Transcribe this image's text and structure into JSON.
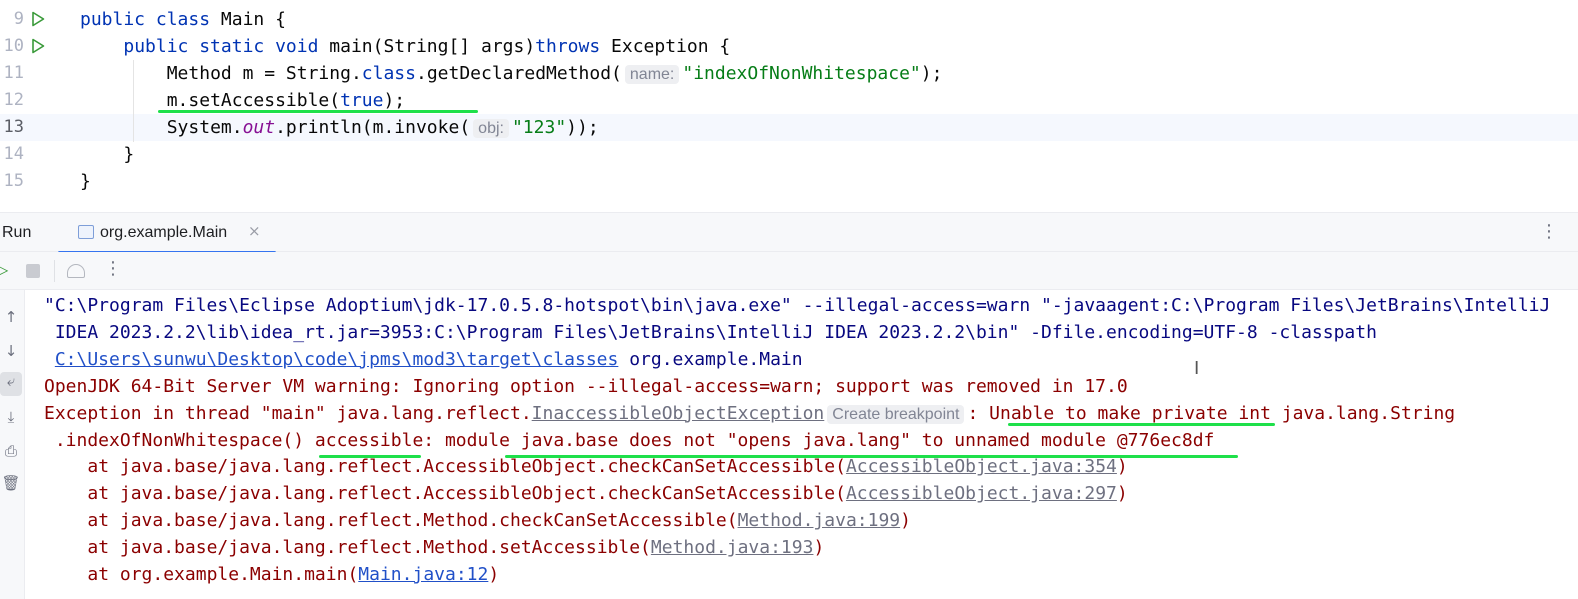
{
  "editor": {
    "current_line": 13,
    "lines": [
      {
        "num": "9",
        "run": true,
        "indent": 0,
        "tokens": [
          {
            "t": "public class ",
            "c": "kw"
          },
          {
            "t": "Main {",
            "c": "pl"
          }
        ]
      },
      {
        "num": "10",
        "run": true,
        "indent": 4,
        "tokens": [
          {
            "t": "public static void ",
            "c": "kw"
          },
          {
            "t": "main(String[] args)",
            "c": "pl"
          },
          {
            "t": "throws ",
            "c": "kw"
          },
          {
            "t": "Exception {",
            "c": "pl"
          }
        ]
      },
      {
        "num": "11",
        "run": false,
        "indent": 8,
        "tokens": [
          {
            "t": "Method m = String.",
            "c": "pl"
          },
          {
            "t": "class",
            "c": "kw"
          },
          {
            "t": ".getDeclaredMethod(",
            "c": "pl"
          },
          {
            "t": "name:",
            "c": "hint"
          },
          {
            "t": "\"indexOfNonWhitespace\"",
            "c": "str"
          },
          {
            "t": ");",
            "c": "pl"
          }
        ]
      },
      {
        "num": "12",
        "run": false,
        "indent": 8,
        "tokens": [
          {
            "t": "m.setAccessible(",
            "c": "pl"
          },
          {
            "t": "true",
            "c": "kw"
          },
          {
            "t": ");",
            "c": "pl"
          }
        ]
      },
      {
        "num": "13",
        "run": false,
        "indent": 8,
        "tokens": [
          {
            "t": "System.",
            "c": "pl"
          },
          {
            "t": "out",
            "c": "fld"
          },
          {
            "t": ".println(m.invoke(",
            "c": "pl"
          },
          {
            "t": "obj:",
            "c": "hint"
          },
          {
            "t": "\"123\"",
            "c": "str"
          },
          {
            "t": "));",
            "c": "pl"
          }
        ]
      },
      {
        "num": "14",
        "run": false,
        "indent": 4,
        "tokens": [
          {
            "t": "}",
            "c": "pl"
          }
        ]
      },
      {
        "num": "15",
        "run": false,
        "indent": 0,
        "tokens": [
          {
            "t": "}",
            "c": "pl"
          }
        ]
      }
    ]
  },
  "run_panel": {
    "title": "Run",
    "tab_label": "org.example.Main",
    "accent": "#3574f0"
  },
  "console": {
    "lines": [
      {
        "indent": 0,
        "tokens": [
          {
            "t": "\"C:\\Program Files\\Eclipse Adoptium\\jdk-17.0.5.8-hotspot\\bin\\java.exe\" --illegal-access=warn \"-javaagent:C:\\Program Files\\JetBrains\\IntelliJ",
            "c": ""
          }
        ]
      },
      {
        "indent": 1,
        "tokens": [
          {
            "t": "IDEA 2023.2.2\\lib\\idea_rt.jar=3953:C:\\Program Files\\JetBrains\\IntelliJ IDEA 2023.2.2\\bin\" -Dfile.encoding=UTF-8 -classpath",
            "c": ""
          }
        ]
      },
      {
        "indent": 1,
        "tokens": [
          {
            "t": "C:\\Users\\sunwu\\Desktop\\code\\jpms\\mod3\\target\\classes",
            "c": "lnk"
          },
          {
            "t": " org.example.Main",
            "c": ""
          }
        ]
      },
      {
        "indent": 0,
        "tokens": [
          {
            "t": "OpenJDK 64-Bit Server VM warning: Ignoring option --illegal-access=warn; support was removed in 17.0",
            "c": "err"
          }
        ]
      },
      {
        "indent": 0,
        "tokens": [
          {
            "t": "Exception in thread \"main\" java.lang.reflect.",
            "c": "err"
          },
          {
            "t": "InaccessibleObjectException",
            "c": "glnk"
          },
          {
            "t": "Create breakpoint",
            "c": "hint"
          },
          {
            "t": ": Unable to make private int java.lang.String",
            "c": "err"
          }
        ]
      },
      {
        "indent": 1,
        "tokens": [
          {
            "t": ".indexOfNonWhitespace() accessible: module java.base does not \"opens java.lang\" to unnamed module @776ec8df",
            "c": "err"
          }
        ]
      },
      {
        "indent": 4,
        "tokens": [
          {
            "t": "at java.base/java.lang.reflect.AccessibleObject.checkCanSetAccessible(",
            "c": "err"
          },
          {
            "t": "AccessibleObject.java:354",
            "c": "glnk"
          },
          {
            "t": ")",
            "c": "err"
          }
        ]
      },
      {
        "indent": 4,
        "tokens": [
          {
            "t": "at java.base/java.lang.reflect.AccessibleObject.checkCanSetAccessible(",
            "c": "err"
          },
          {
            "t": "AccessibleObject.java:297",
            "c": "glnk"
          },
          {
            "t": ")",
            "c": "err"
          }
        ]
      },
      {
        "indent": 4,
        "tokens": [
          {
            "t": "at java.base/java.lang.reflect.Method.checkCanSetAccessible(",
            "c": "err"
          },
          {
            "t": "Method.java:199",
            "c": "glnk"
          },
          {
            "t": ")",
            "c": "err"
          }
        ]
      },
      {
        "indent": 4,
        "tokens": [
          {
            "t": "at java.base/java.lang.reflect.Method.setAccessible(",
            "c": "err"
          },
          {
            "t": "Method.java:193",
            "c": "glnk"
          },
          {
            "t": ")",
            "c": "err"
          }
        ]
      },
      {
        "indent": 4,
        "tokens": [
          {
            "t": "at org.example.Main.main(",
            "c": "err"
          },
          {
            "t": "Main.java:12",
            "c": "lnk"
          },
          {
            "t": ")",
            "c": "err"
          }
        ]
      }
    ]
  }
}
